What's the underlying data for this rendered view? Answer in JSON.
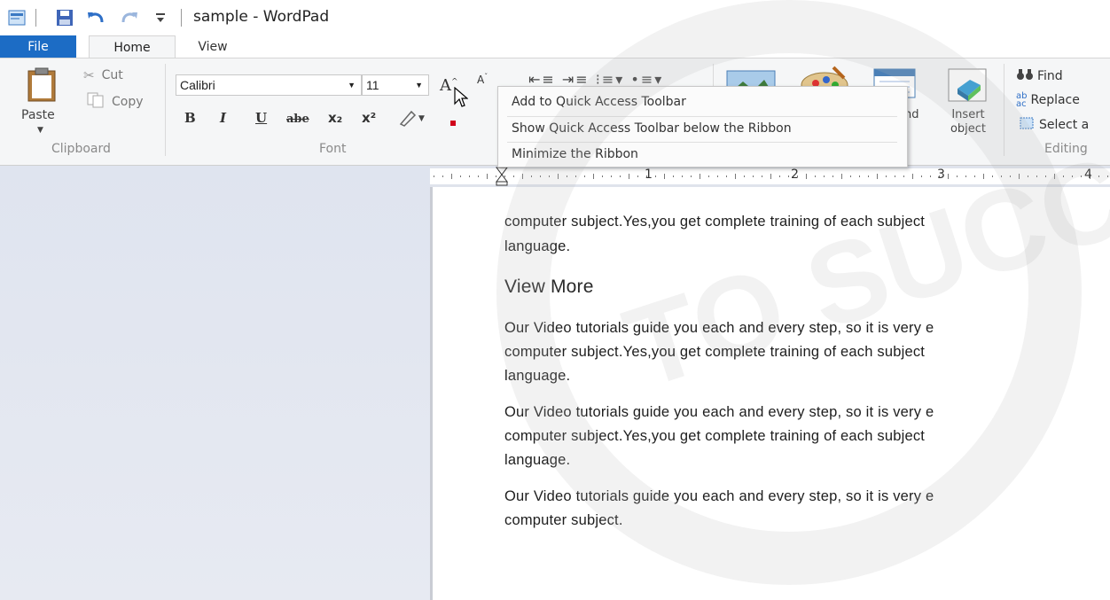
{
  "title_bar": {
    "title": "sample - WordPad",
    "icons": [
      "wordpad-app-icon",
      "save-icon",
      "undo-icon",
      "redo-icon",
      "customize-qat-icon"
    ]
  },
  "tabs": [
    {
      "label": "File"
    },
    {
      "label": "Home"
    },
    {
      "label": "View"
    }
  ],
  "ribbon": {
    "clipboard": {
      "paste_label": "Paste",
      "cut_label": "Cut",
      "copy_label": "Copy",
      "group_label": "Clipboard"
    },
    "font": {
      "font_name": "Calibri",
      "font_size": "11",
      "bold": "B",
      "italic": "I",
      "underline": "U",
      "strikethrough": "abe",
      "subscript": "x₂",
      "superscript": "x²",
      "group_label": "Font"
    },
    "insert": {
      "partial_label_line1": "nd",
      "insert_object_line1": "Insert",
      "insert_object_line2": "object"
    },
    "editing": {
      "find_label": "Find",
      "replace_label": "Replace",
      "select_all_label": "Select a",
      "group_label": "Editing"
    }
  },
  "context_menu": {
    "items": [
      {
        "label": "Add to Quick Access Toolbar"
      },
      {
        "label": "Show Quick Access Toolbar below the Ribbon"
      },
      {
        "label": "Minimize the Ribbon"
      }
    ]
  },
  "ruler": {
    "marks": [
      "1",
      "2",
      "3",
      "4"
    ]
  },
  "document": {
    "lines": [
      {
        "text": "computer subject.Yes,you get complete training of each subject"
      },
      {
        "text": "language."
      },
      {
        "text": "View More",
        "heading": true
      },
      {
        "text": "Our Video tutorials guide you each and every step, so it is very e"
      },
      {
        "text": "computer subject.Yes,you get complete training of each subject"
      },
      {
        "text": "language."
      },
      {
        "text": "Our Video tutorials guide you each and every step, so it is very e"
      },
      {
        "text": "computer subject.Yes,you get complete training of each subject"
      },
      {
        "text": "language."
      },
      {
        "text": "Our Video tutorials guide you each and every step, so it is very e"
      },
      {
        "text": "computer subject."
      }
    ]
  },
  "colors": {
    "file_tab": "#1c6cc5",
    "ribbon_bg": "#f5f6f7",
    "side_bg": "#e2e6ef",
    "font_color_red": "#d0021b"
  }
}
